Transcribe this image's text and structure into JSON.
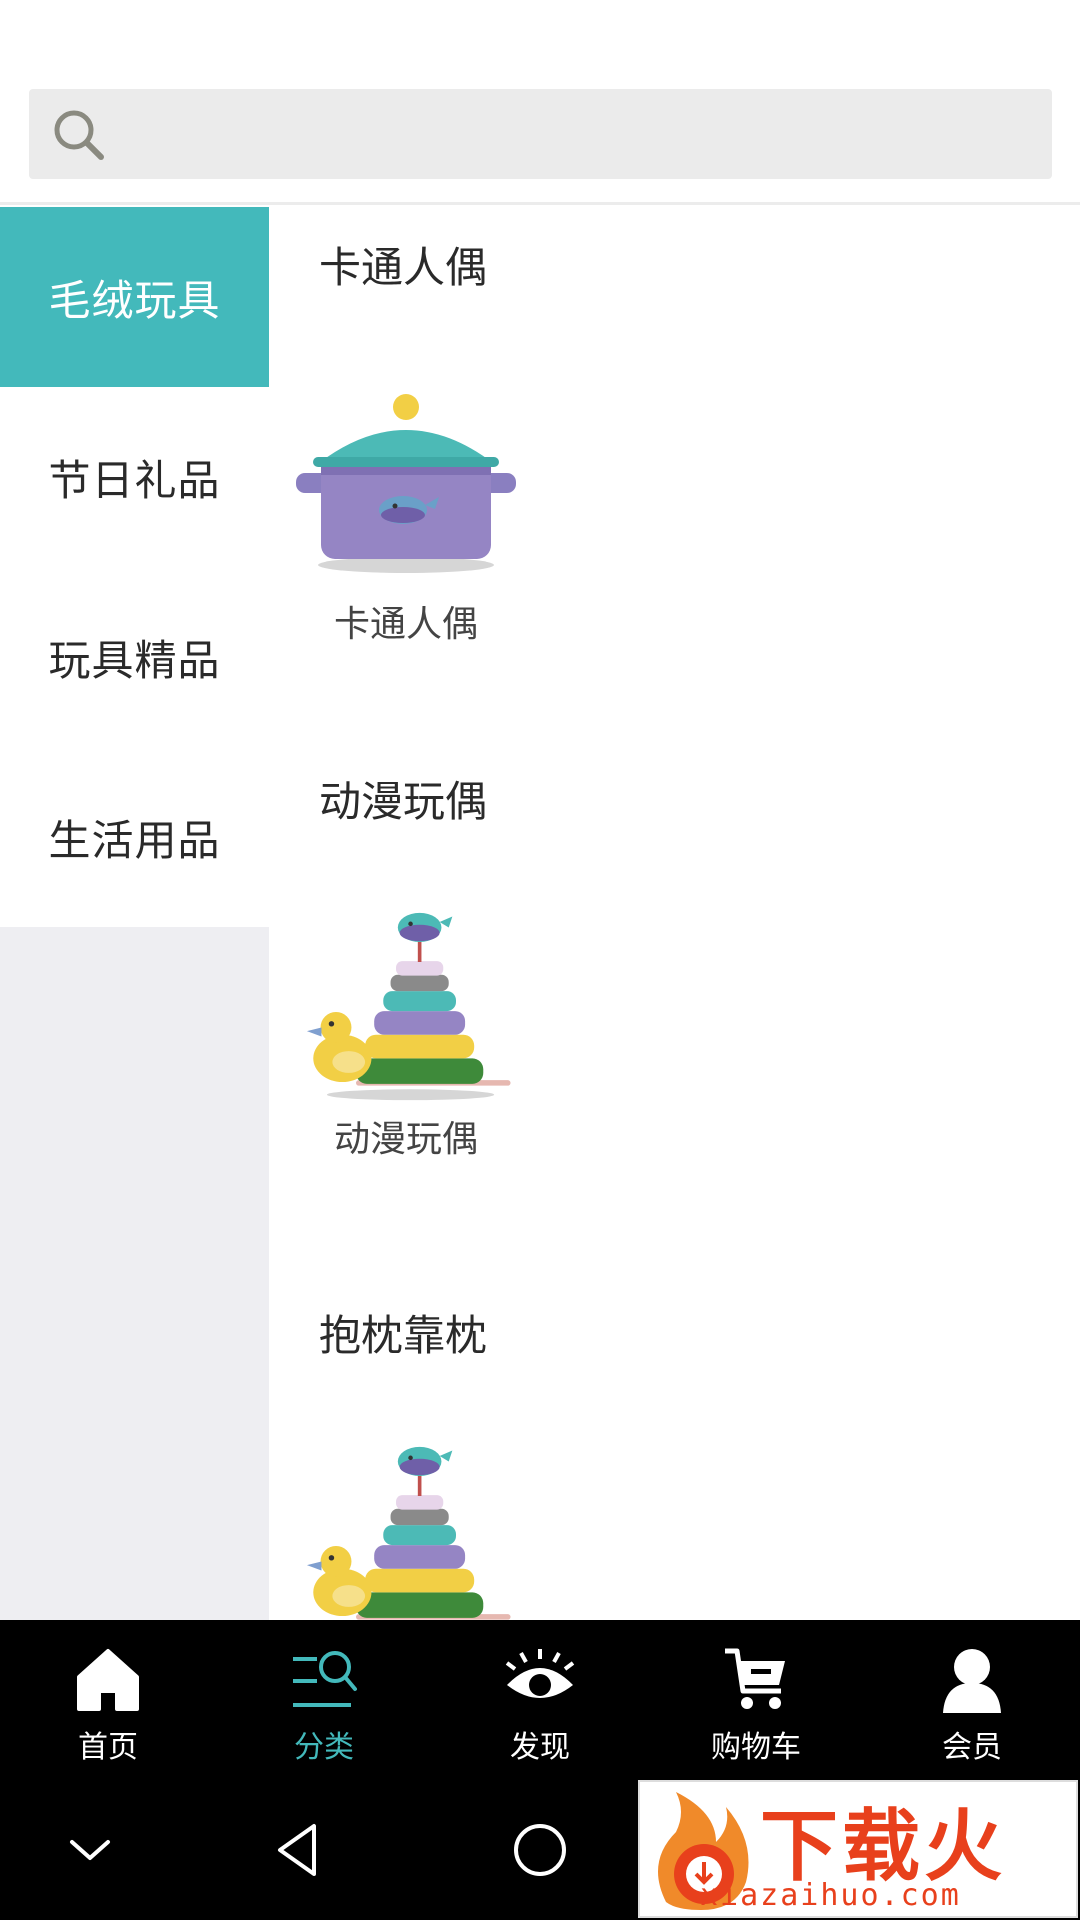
{
  "search": {
    "placeholder": ""
  },
  "sidebar": {
    "items": [
      {
        "label": "毛绒玩具",
        "active": true
      },
      {
        "label": "节日礼品",
        "active": false
      },
      {
        "label": "玩具精品",
        "active": false
      },
      {
        "label": "生活用品",
        "active": false
      }
    ]
  },
  "sections": [
    {
      "title": "卡通人偶",
      "product_label": "卡通人偶",
      "image": "pot-icon"
    },
    {
      "title": "动漫玩偶",
      "product_label": "动漫玩偶",
      "image": "ring-stack-duck-icon"
    },
    {
      "title": "抱枕靠枕",
      "product_label": "",
      "image": "ring-stack-duck-icon"
    }
  ],
  "tabbar": {
    "items": [
      {
        "label": "首页",
        "icon": "home-icon",
        "active": false
      },
      {
        "label": "分类",
        "icon": "category-search-icon",
        "active": true
      },
      {
        "label": "发现",
        "icon": "eye-icon",
        "active": false
      },
      {
        "label": "购物车",
        "icon": "cart-icon",
        "active": false
      },
      {
        "label": "会员",
        "icon": "user-icon",
        "active": false
      }
    ]
  },
  "watermark": {
    "text": "下载火",
    "url": "xiazaihuo.com"
  },
  "colors": {
    "accent": "#43b9bb",
    "tabbar_bg": "#000000",
    "sidebar_bg": "#eeeef2"
  }
}
